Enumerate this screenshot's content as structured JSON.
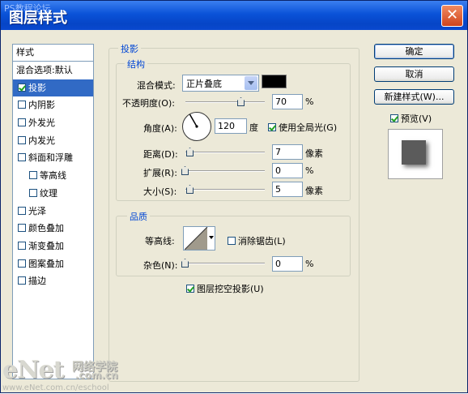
{
  "window": {
    "watermark_top": "PS教程论坛",
    "title": "图层样式",
    "close_symbol": "✕"
  },
  "styles_panel": {
    "header": "样式",
    "blend_options": "混合选项:默认",
    "items": [
      {
        "label": "投影",
        "checked": true,
        "selected": true,
        "sub": false
      },
      {
        "label": "内阴影",
        "checked": false,
        "sub": false
      },
      {
        "label": "外发光",
        "checked": false,
        "sub": false
      },
      {
        "label": "内发光",
        "checked": false,
        "sub": false
      },
      {
        "label": "斜面和浮雕",
        "checked": false,
        "sub": false
      },
      {
        "label": "等高线",
        "checked": false,
        "sub": true
      },
      {
        "label": "纹理",
        "checked": false,
        "sub": true
      },
      {
        "label": "光泽",
        "checked": false,
        "sub": false
      },
      {
        "label": "颜色叠加",
        "checked": false,
        "sub": false
      },
      {
        "label": "渐变叠加",
        "checked": false,
        "sub": false
      },
      {
        "label": "图案叠加",
        "checked": false,
        "sub": false
      },
      {
        "label": "描边",
        "checked": false,
        "sub": false
      }
    ]
  },
  "drop_shadow": {
    "section_title": "投影",
    "structure": {
      "title": "结构",
      "blend_mode_label": "混合模式:",
      "blend_mode_value": "正片叠底",
      "shadow_color": "#000000",
      "opacity_label": "不透明度(O):",
      "opacity_value": "70",
      "opacity_unit": "%",
      "opacity_level": 0.7,
      "angle_label": "角度(A):",
      "angle_value": "120",
      "angle_unit": "度",
      "global_light_label": "使用全局光(G)",
      "global_light_checked": true,
      "distance_label": "距离(D):",
      "distance_value": "7",
      "distance_unit": "像素",
      "spread_label": "扩展(R):",
      "spread_value": "0",
      "spread_unit": "%",
      "size_label": "大小(S):",
      "size_value": "5",
      "size_unit": "像素"
    },
    "quality": {
      "title": "品质",
      "contour_label": "等高线:",
      "anti_alias_label": "消除锯齿(L)",
      "noise_label": "杂色(N):",
      "noise_value": "0",
      "noise_unit": "%"
    },
    "knockout_label": "图层挖空投影(U)",
    "knockout_checked": true
  },
  "buttons": {
    "ok": "确定",
    "cancel": "取消",
    "new_style": "新建样式(W)...",
    "preview_label": "预览(V)",
    "preview_checked": true
  },
  "watermark": {
    "logo": "eNet",
    "cn": "网络学院",
    "domain": ".com.cn",
    "url": "www.eNet.com.cn/eschool"
  }
}
